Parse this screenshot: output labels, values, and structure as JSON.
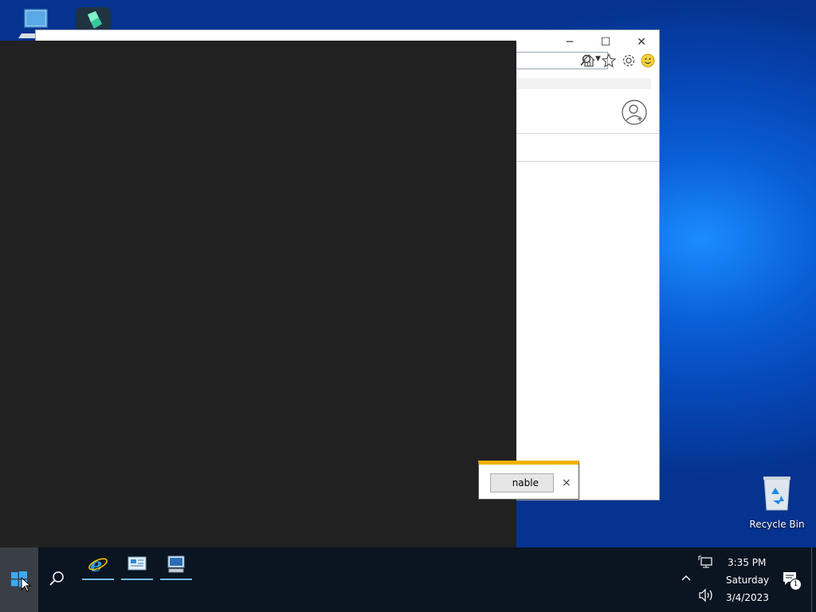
{
  "desktop": {
    "recycle_bin_label": "Recycle Bin"
  },
  "ie_window": {
    "controls": {
      "minimize": "─",
      "maximize": "☐",
      "close": "✕"
    }
  },
  "notification": {
    "button_label": "nable",
    "close_label": "×"
  },
  "taskbar": {
    "clock": {
      "time": "3:35 PM",
      "day": "Saturday",
      "date": "3/4/2023"
    },
    "notification_count": "1"
  },
  "colors": {
    "accent": "#f2b100",
    "taskbar": "#0b1421",
    "dark_pane": "#212121"
  }
}
